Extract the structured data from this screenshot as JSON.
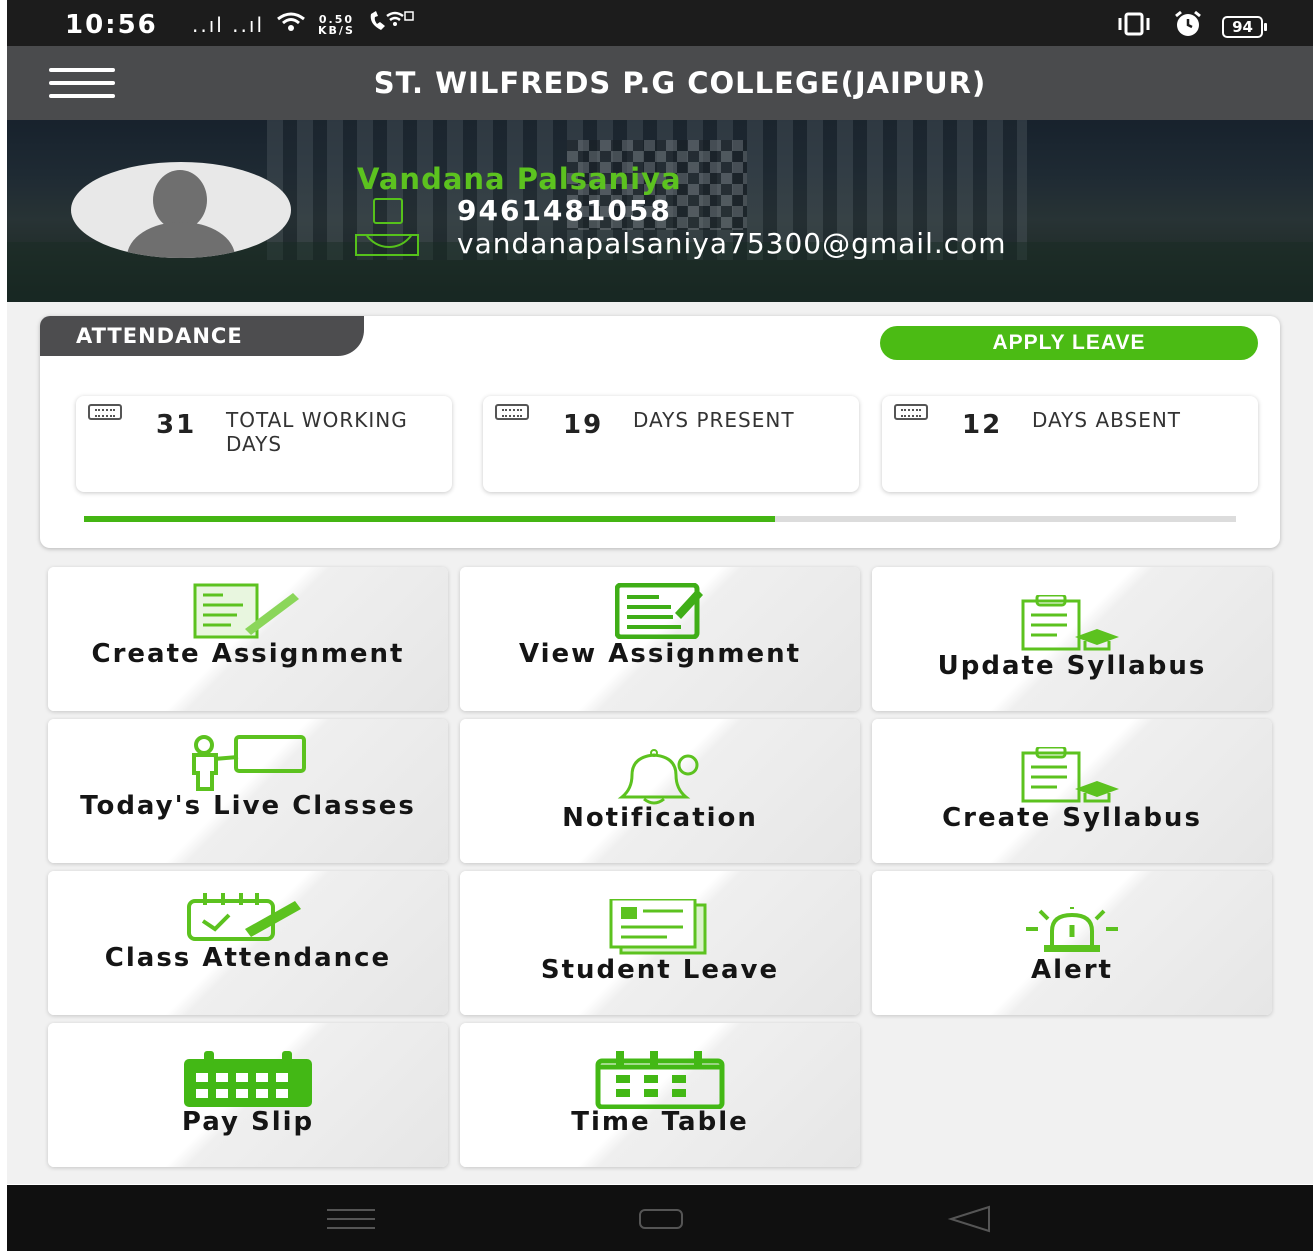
{
  "status_bar": {
    "time": "10:56",
    "signal": "..ıl ..ıl",
    "net_speed_value": "0.50",
    "net_speed_unit": "KB/S",
    "battery": "94"
  },
  "app_bar": {
    "title": "ST. WILFREDS P.G COLLEGE(JAIPUR)"
  },
  "profile": {
    "name": "Vandana Palsaniya",
    "phone": "9461481058",
    "email": "vandanapalsaniya75300@gmail.com"
  },
  "attendance": {
    "tab_label": "ATTENDANCE",
    "apply_leave_label": "APPLY LEAVE",
    "stats": [
      {
        "value": "31",
        "label": "TOTAL WORKING DAYS"
      },
      {
        "value": "19",
        "label": "DAYS PRESENT"
      },
      {
        "value": "12",
        "label": "DAYS ABSENT"
      }
    ],
    "present_fraction": 0.6
  },
  "menu": [
    {
      "label": "Create Assignment",
      "icon": "create-assignment-icon"
    },
    {
      "label": "View Assignment",
      "icon": "view-assignment-icon"
    },
    {
      "label": "Update Syllabus",
      "icon": "update-syllabus-icon"
    },
    {
      "label": "Today's Live Classes",
      "icon": "live-classes-icon"
    },
    {
      "label": "Notification",
      "icon": "notification-bell-icon"
    },
    {
      "label": "Create Syllabus",
      "icon": "create-syllabus-icon"
    },
    {
      "label": "Class Attendance",
      "icon": "class-attendance-icon"
    },
    {
      "label": "Student Leave",
      "icon": "student-leave-icon"
    },
    {
      "label": "Alert",
      "icon": "alert-siren-icon"
    },
    {
      "label": "Pay Slip",
      "icon": "pay-slip-calendar-icon"
    },
    {
      "label": "Time Table",
      "icon": "time-table-calendar-icon"
    }
  ],
  "colors": {
    "accent_green": "#4bbb14",
    "app_bar": "#4a4b4d"
  }
}
